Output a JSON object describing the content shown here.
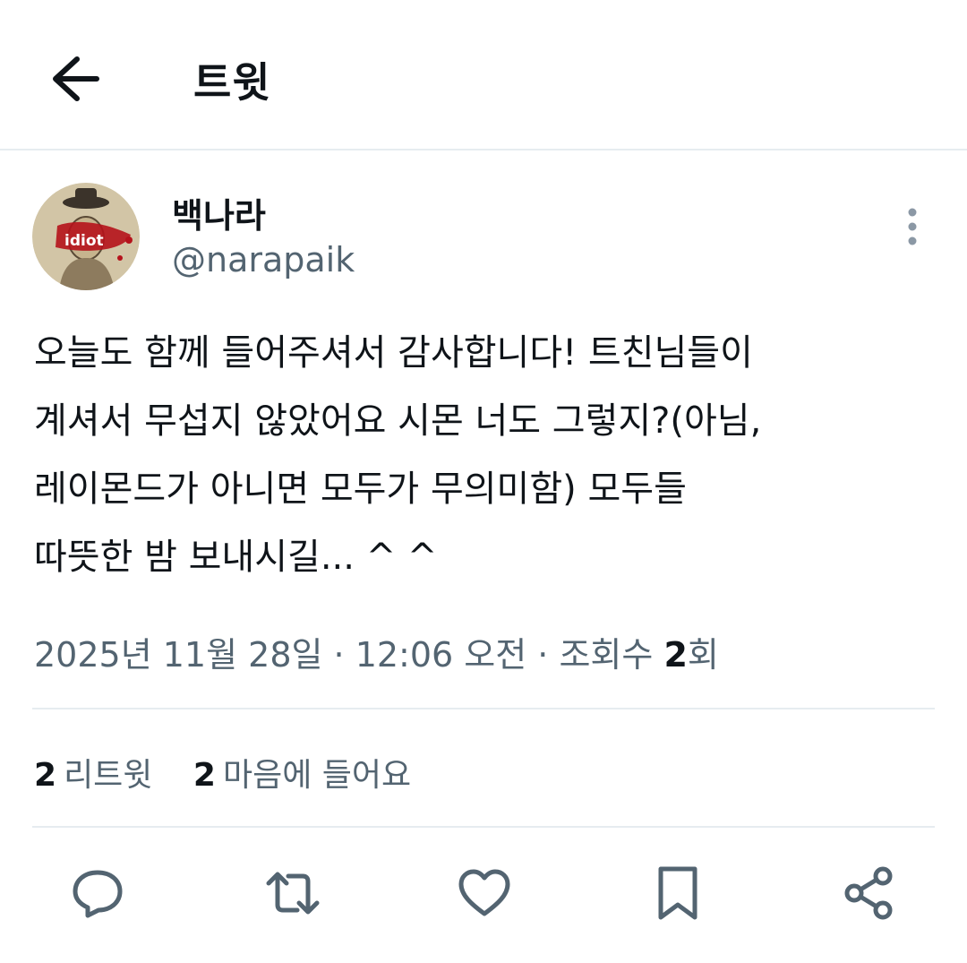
{
  "header": {
    "title": "트윗",
    "back_icon": "arrow-left-icon"
  },
  "author": {
    "display_name": "백나라",
    "handle": "@narapaik",
    "avatar_text": "idiot"
  },
  "tweet": {
    "lines": [
      "오늘도 함께 들어주셔서 감사합니다! 트친님들이",
      "계셔서 무섭지 않았어요 시몬 너도 그렇지?(아님,",
      "레이몬드가 아니면 모두가 무의미함) 모두들",
      "따뜻한 밤 보내시길... ^ ^"
    ]
  },
  "meta": {
    "date": "2025년 11월 28일",
    "sep1": " · ",
    "time": "12:06 오전",
    "sep2": " · ",
    "views_label": "조회수 ",
    "views_count": "2",
    "views_suffix": "회"
  },
  "stats": {
    "retweets_count": "2",
    "retweets_label": "리트윗",
    "likes_count": "2",
    "likes_label": "마음에 들어요"
  },
  "actions": [
    {
      "icon": "reply-icon"
    },
    {
      "icon": "retweet-icon"
    },
    {
      "icon": "like-icon"
    },
    {
      "icon": "bookmark-icon"
    },
    {
      "icon": "share-icon"
    }
  ],
  "colors": {
    "text": "#0f1419",
    "secondary": "#536471",
    "divider": "#e6ecf0"
  }
}
